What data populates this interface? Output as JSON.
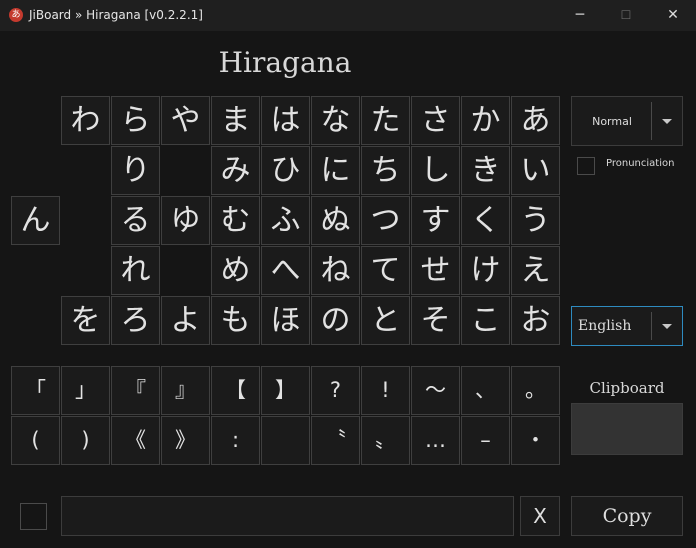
{
  "window": {
    "title": "JiBoard » Hiragana [v0.2.2.1]",
    "app_icon_glyph": "あ",
    "minimize_glyph": "─",
    "maximize_glyph": "☐",
    "close_glyph": "✕"
  },
  "heading": "Hiragana",
  "kana_grid": {
    "rows": [
      [
        "",
        "わ",
        "ら",
        "や",
        "ま",
        "は",
        "な",
        "た",
        "さ",
        "か",
        "あ"
      ],
      [
        "",
        "",
        "り",
        "",
        "み",
        "ひ",
        "に",
        "ち",
        "し",
        "き",
        "い"
      ],
      [
        "ん",
        "",
        "る",
        "ゆ",
        "む",
        "ふ",
        "ぬ",
        "つ",
        "す",
        "く",
        "う"
      ],
      [
        "",
        "",
        "れ",
        "",
        "め",
        "へ",
        "ね",
        "て",
        "せ",
        "け",
        "え"
      ],
      [
        "",
        "を",
        "ろ",
        "よ",
        "も",
        "ほ",
        "の",
        "と",
        "そ",
        "こ",
        "お"
      ]
    ]
  },
  "symbols_grid": {
    "rows": [
      [
        "「",
        "」",
        "『",
        "』",
        "【",
        "】",
        "?",
        "!",
        "〜",
        "、",
        "。"
      ],
      [
        "(",
        ")",
        "《",
        "》",
        ":",
        "",
        "〝",
        "〟",
        "…",
        "–",
        "・"
      ]
    ]
  },
  "mode_select": {
    "value": "Normal"
  },
  "pronunciation": {
    "label": "Pronunciation",
    "checked": false
  },
  "language_select": {
    "value": "English"
  },
  "clipboard": {
    "label": "Clipboard",
    "content": ""
  },
  "bottom": {
    "text_value": "",
    "clear_label": "X",
    "copy_label": "Copy"
  },
  "colors": {
    "accent": "#2e8bc0",
    "background": "#151515",
    "key_border": "#3f3f3f"
  }
}
